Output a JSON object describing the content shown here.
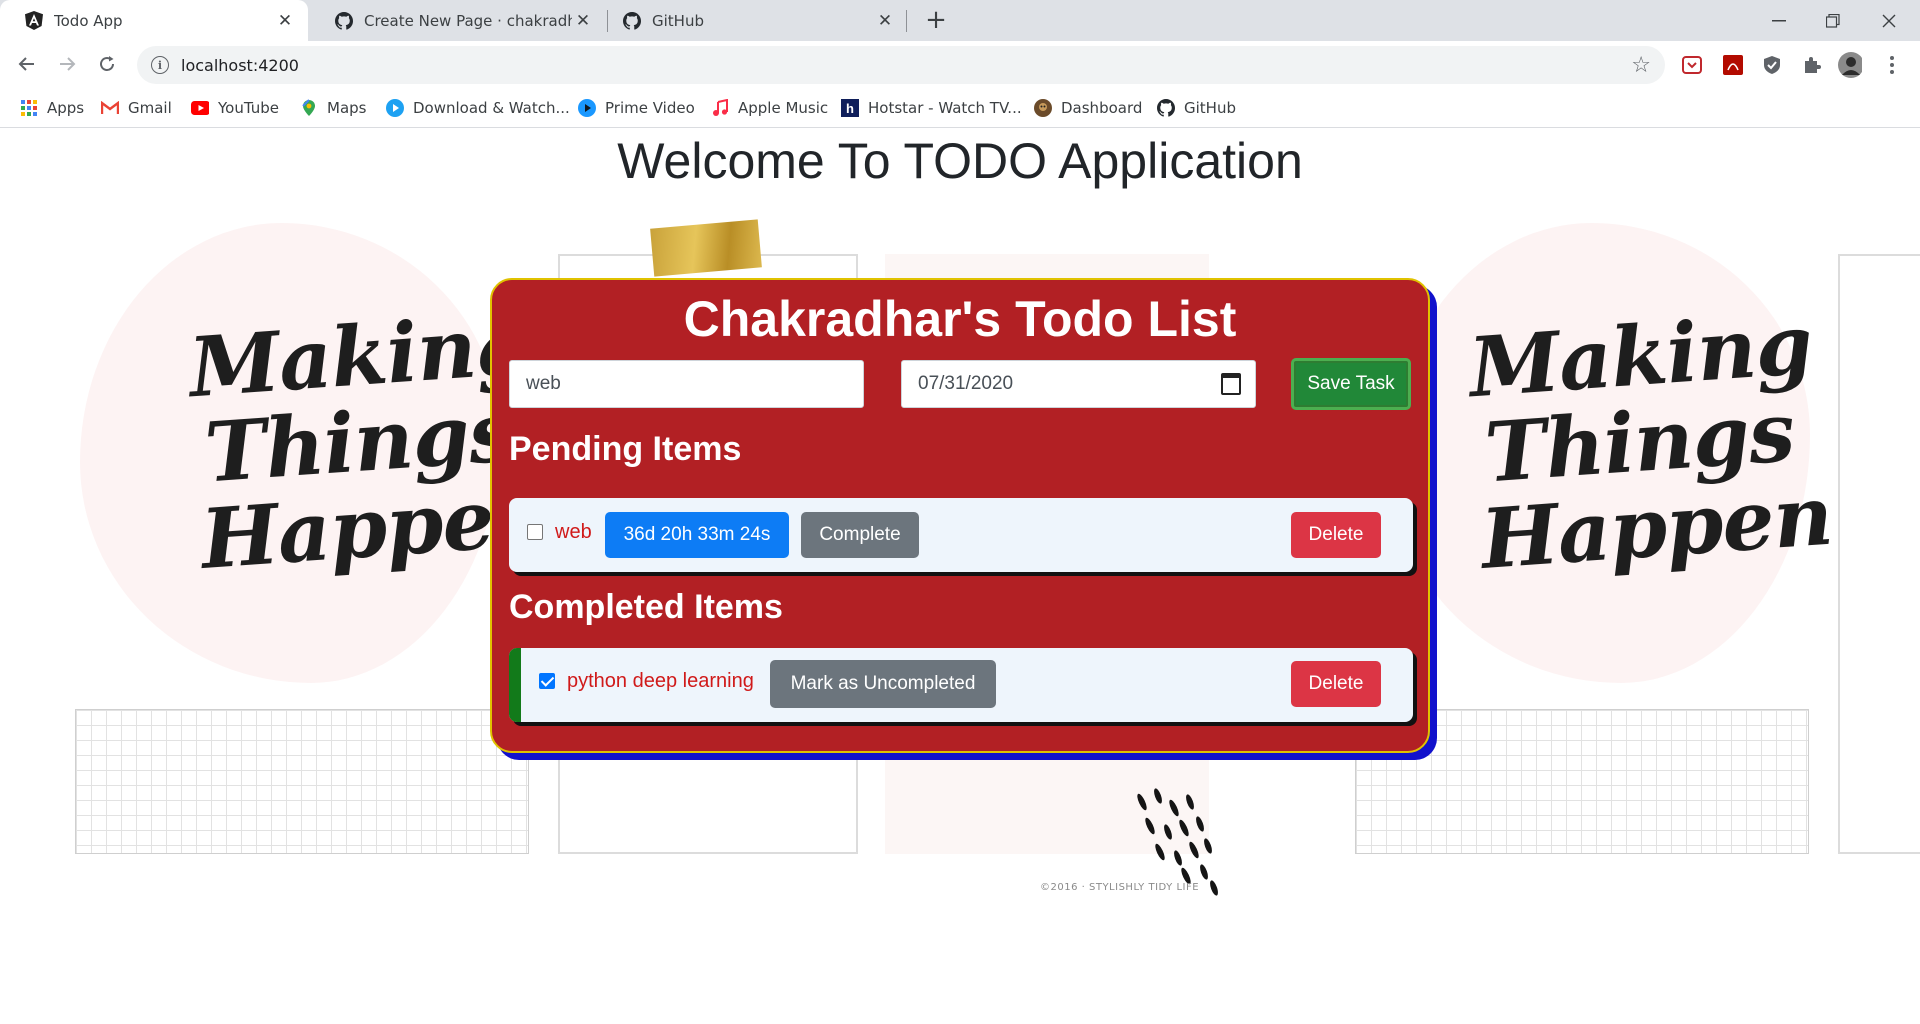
{
  "browser": {
    "tabs": [
      {
        "title": "Todo App",
        "icon": "angular-icon",
        "active": true
      },
      {
        "title": "Create New Page · chakradharchi",
        "icon": "github-icon",
        "active": false
      },
      {
        "title": "GitHub",
        "icon": "github-icon",
        "active": false
      }
    ],
    "new_tab": "+",
    "url": "localhost:4200",
    "bookmarks": [
      {
        "label": "Apps",
        "icon": "apps-grid-icon"
      },
      {
        "label": "Gmail",
        "icon": "gmail-icon"
      },
      {
        "label": "YouTube",
        "icon": "youtube-icon"
      },
      {
        "label": "Maps",
        "icon": "maps-icon"
      },
      {
        "label": "Download & Watch...",
        "icon": "download-watch-icon"
      },
      {
        "label": "Prime Video",
        "icon": "prime-video-icon"
      },
      {
        "label": "Apple Music",
        "icon": "apple-music-icon"
      },
      {
        "label": "Hotstar - Watch TV...",
        "icon": "hotstar-icon"
      },
      {
        "label": "Dashboard",
        "icon": "dashboard-icon"
      },
      {
        "label": "GitHub",
        "icon": "github-icon"
      }
    ]
  },
  "page": {
    "heading": "Welcome To TODO Application",
    "background": {
      "poster_text": [
        "Making",
        "Things",
        "Happen"
      ],
      "footnote": "©2016 · STYLISHLY TIDY LIFE"
    }
  },
  "todo": {
    "title": "Chakradhar's Todo List",
    "task_input_value": "web",
    "date_input_value": "07/31/2020",
    "save_label": "Save Task",
    "pending_heading": "Pending Items",
    "pending": [
      {
        "text": "web",
        "checked": false,
        "timer": "36d 20h 33m 24s",
        "action": "Complete",
        "delete": "Delete"
      }
    ],
    "completed_heading": "Completed Items",
    "completed": [
      {
        "text": "python deep learning",
        "checked": true,
        "action": "Mark as Uncompleted",
        "delete": "Delete"
      }
    ]
  },
  "colors": {
    "card_bg": "#b22024",
    "card_border": "#e0c200",
    "card_shadow": "#1111cc",
    "save_green": "#218838",
    "timer_blue": "#0d7cf5",
    "delete_red": "#dc3545",
    "secondary_gray": "#6c757d",
    "completed_stripe": "#127a1a",
    "item_text_red": "#d01a1a"
  }
}
